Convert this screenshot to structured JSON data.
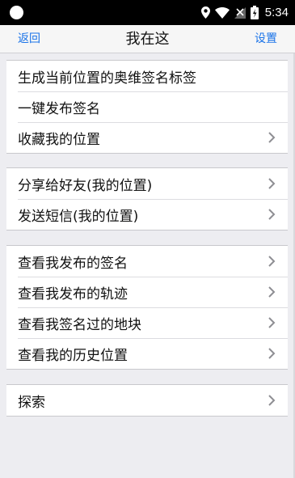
{
  "status_bar": {
    "time": "5:34",
    "icons": [
      "location-icon",
      "wifi-icon",
      "signal-icon",
      "battery-icon"
    ]
  },
  "nav": {
    "back_label": "返回",
    "title": "我在这",
    "settings_label": "设置"
  },
  "groups": [
    {
      "items": [
        {
          "label": "生成当前位置的奥维签名标签",
          "chevron": false
        },
        {
          "label": "一键发布签名",
          "chevron": false
        },
        {
          "label": "收藏我的位置",
          "chevron": true
        }
      ]
    },
    {
      "items": [
        {
          "label": "分享给好友(我的位置)",
          "chevron": true
        },
        {
          "label": "发送短信(我的位置)",
          "chevron": true
        }
      ]
    },
    {
      "items": [
        {
          "label": "查看我发布的签名",
          "chevron": true
        },
        {
          "label": "查看我发布的轨迹",
          "chevron": true
        },
        {
          "label": "查看我签名过的地块",
          "chevron": true
        },
        {
          "label": "查看我的历史位置",
          "chevron": true
        }
      ]
    },
    {
      "items": [
        {
          "label": "探索",
          "chevron": true
        }
      ]
    }
  ],
  "colors": {
    "accent": "#1a73e8",
    "background": "#ededf1",
    "status_bar": "#000000"
  }
}
